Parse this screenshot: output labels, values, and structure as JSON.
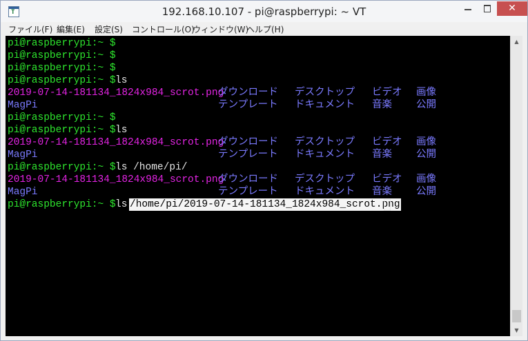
{
  "window": {
    "title": "192.168.10.107 - pi@raspberrypi: ~ VT",
    "icon_text": "T",
    "minimize_icon": "minimize-icon",
    "maximize_icon": "maximize-icon",
    "close_icon": "close-icon",
    "close_glyph": "✕"
  },
  "menu": {
    "file": "ファイル(F)",
    "edit": "編集(E)",
    "setup": "設定(S)",
    "control": "コントロール(O)",
    "window": "ウィンドウ(W)",
    "help": "ヘルプ(H)"
  },
  "terminal": {
    "prompt": "pi@raspberrypi:~ $",
    "colors": {
      "prompt": "#2ee62e",
      "file": "#e524e5",
      "dir": "#7a7aff",
      "text": "#e6e6e6"
    },
    "cmd_ls": "ls",
    "cmd_ls_home": "ls /home/pi/",
    "cmd_ls_prefix": "ls",
    "selected_path": "/home/pi/2019-07-14-181134_1824x984_scrot.png",
    "file_png": "2019-07-14-181134_1824x984_scrot.png",
    "file_magpi": "MagPi",
    "dir_download": "ダウンロード",
    "dir_desktop": "デスクトップ",
    "dir_video": "ビデオ",
    "dir_pictures": "画像",
    "dir_templates": "テンプレート",
    "dir_documents": "ドキュメント",
    "dir_music": "音楽",
    "dir_public": "公開"
  },
  "scrollbar": {
    "up_glyph": "▲",
    "down_glyph": "▼"
  }
}
